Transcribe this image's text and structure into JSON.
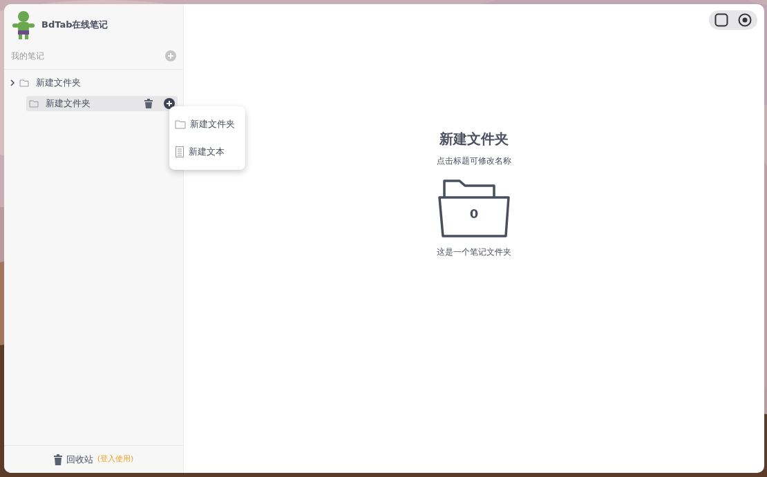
{
  "app": {
    "title": "BdTab在线笔记"
  },
  "sidebar": {
    "section_label": "我的笔记",
    "tree": [
      {
        "label": "新建文件夹",
        "kind": "folder",
        "selected": false,
        "expanded": false,
        "children": [
          {
            "label": "新建文件夹",
            "kind": "folder",
            "selected": true
          }
        ]
      }
    ],
    "trash": {
      "label": "回收站",
      "note": "(登入使用)"
    }
  },
  "context_menu": [
    {
      "kind": "folder",
      "label": "新建文件夹"
    },
    {
      "kind": "text",
      "label": "新建文本"
    }
  ],
  "window_controls": [
    {
      "kind": "square"
    },
    {
      "kind": "dot"
    }
  ],
  "main": {
    "title": "新建文件夹",
    "hint": "点击标题可修改名称",
    "count": "0",
    "caption": "这是一个笔记文件夹"
  }
}
